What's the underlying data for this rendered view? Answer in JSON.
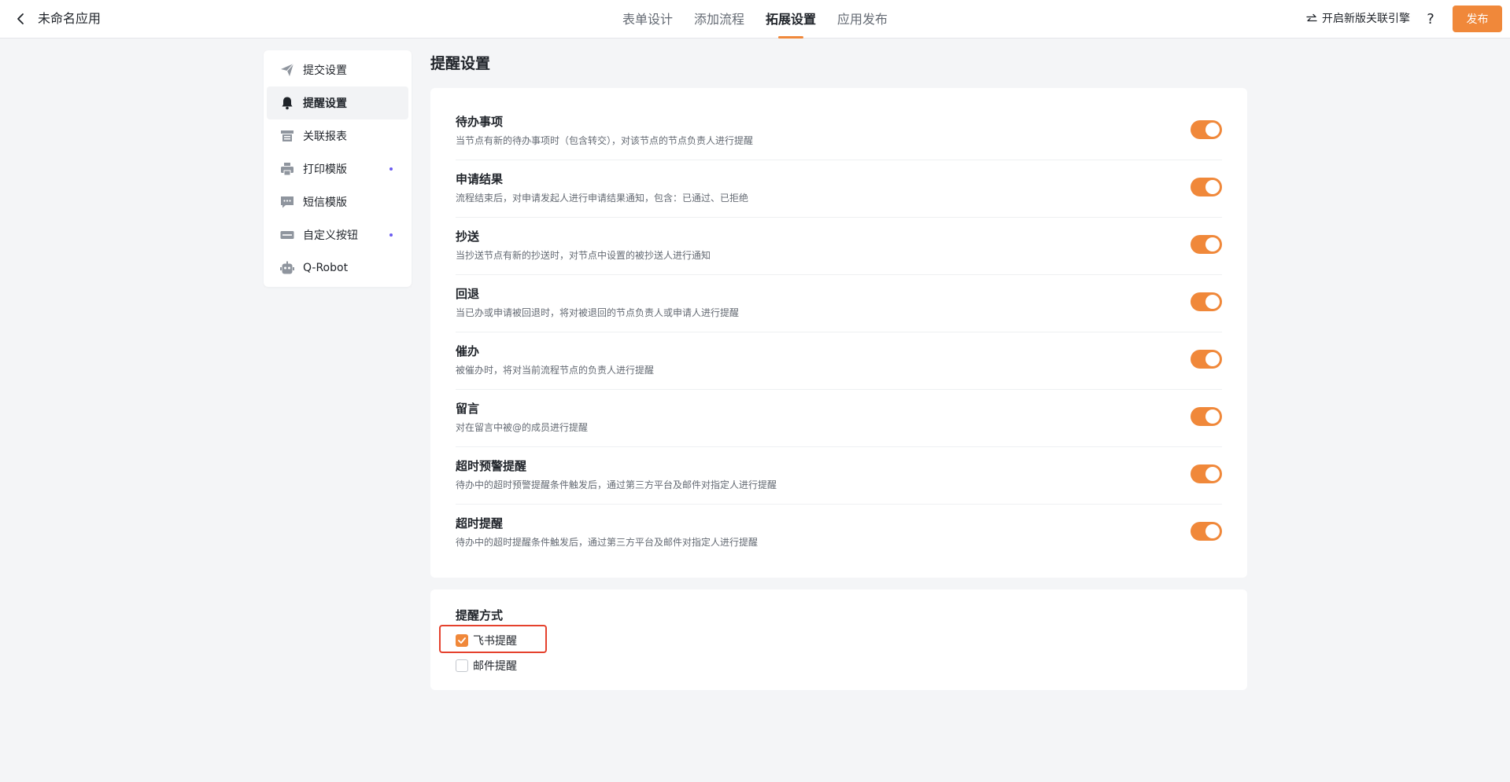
{
  "header": {
    "back_icon": "chevron-left-icon",
    "app_title": "未命名应用",
    "tabs": [
      {
        "label": "表单设计",
        "active": false
      },
      {
        "label": "添加流程",
        "active": false
      },
      {
        "label": "拓展设置",
        "active": true
      },
      {
        "label": "应用发布",
        "active": false
      }
    ],
    "engine_icon": "swap-arrows-icon",
    "engine_link": "开启新版关联引擎",
    "help_icon": "question-icon",
    "publish_label": "发布"
  },
  "sidebar": {
    "items": [
      {
        "label": "提交设置",
        "icon": "paper-plane-icon",
        "active": false,
        "dot": false
      },
      {
        "label": "提醒设置",
        "icon": "bell-icon",
        "active": true,
        "dot": false
      },
      {
        "label": "关联报表",
        "icon": "report-icon",
        "active": false,
        "dot": false
      },
      {
        "label": "打印模版",
        "icon": "printer-icon",
        "active": false,
        "dot": true
      },
      {
        "label": "短信模版",
        "icon": "message-icon",
        "active": false,
        "dot": false
      },
      {
        "label": "自定义按钮",
        "icon": "button-icon",
        "active": false,
        "dot": true
      },
      {
        "label": "Q-Robot",
        "icon": "robot-icon",
        "active": false,
        "dot": false
      }
    ]
  },
  "main": {
    "title": "提醒设置",
    "reminders": [
      {
        "title": "待办事项",
        "desc": "当节点有新的待办事项时（包含转交），对该节点的节点负责人进行提醒",
        "enabled": true
      },
      {
        "title": "申请结果",
        "desc": "流程结束后，对申请发起人进行申请结果通知，包含：已通过、已拒绝",
        "enabled": true
      },
      {
        "title": "抄送",
        "desc": "当抄送节点有新的抄送时，对节点中设置的被抄送人进行通知",
        "enabled": true
      },
      {
        "title": "回退",
        "desc": "当已办或申请被回退时，将对被退回的节点负责人或申请人进行提醒",
        "enabled": true
      },
      {
        "title": "催办",
        "desc": "被催办时，将对当前流程节点的负责人进行提醒",
        "enabled": true
      },
      {
        "title": "留言",
        "desc": "对在留言中被@的成员进行提醒",
        "enabled": true
      },
      {
        "title": "超时预警提醒",
        "desc": "待办中的超时预警提醒条件触发后，通过第三方平台及邮件对指定人进行提醒",
        "enabled": true
      },
      {
        "title": "超时提醒",
        "desc": "待办中的超时提醒条件触发后，通过第三方平台及邮件对指定人进行提醒",
        "enabled": true
      }
    ],
    "method": {
      "title": "提醒方式",
      "options": [
        {
          "label": "飞书提醒",
          "checked": true
        },
        {
          "label": "邮件提醒",
          "checked": false
        }
      ]
    }
  },
  "colors": {
    "accent": "#f0883a",
    "highlight": "#e5412d",
    "dot": "#6b5cf0"
  }
}
